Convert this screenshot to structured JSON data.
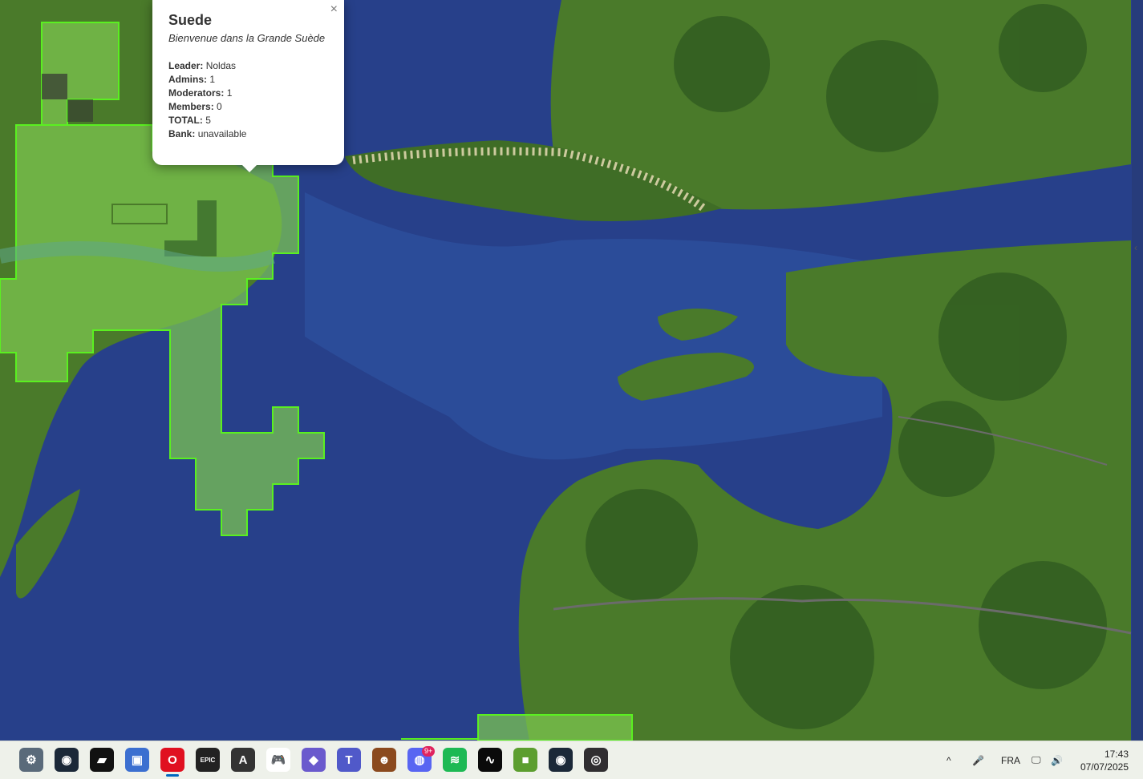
{
  "popup": {
    "title": "Suede",
    "subtitle": "Bienvenue dans la Grande Suède",
    "close_label": "×",
    "leader_label": "Leader:",
    "leader_value": "Noldas",
    "admins_label": "Admins:",
    "admins_value": "1",
    "moderators_label": "Moderators:",
    "moderators_value": "1",
    "members_label": "Members:",
    "members_value": "0",
    "total_label": "TOTAL:",
    "total_value": "5",
    "bank_label": "Bank:",
    "bank_value": "unavailable"
  },
  "colors": {
    "ocean_deep": "#27408a",
    "ocean_shallow": "#2f55a6",
    "land": "#4f7a2a",
    "forest": "#2f5a20",
    "claim_fill": "#7ec850",
    "claim_border": "#5af020",
    "sand": "#e6dbb4",
    "taskbar": "#eef1ea"
  },
  "taskbar": {
    "apps": [
      {
        "name": "settings-icon",
        "glyph": "⚙",
        "color": "#5a6a7a"
      },
      {
        "name": "steam-icon",
        "glyph": "◉",
        "color": "#1b2838"
      },
      {
        "name": "game-launcher-icon",
        "glyph": "▰",
        "color": "#111111"
      },
      {
        "name": "folder-app-icon",
        "glyph": "▣",
        "color": "#3b6fd0"
      },
      {
        "name": "opera-icon",
        "glyph": "O",
        "color": "#e01020"
      },
      {
        "name": "epic-games-icon",
        "glyph": "EPIC",
        "color": "#222222"
      },
      {
        "name": "launcher-a-icon",
        "glyph": "A",
        "color": "#333333"
      },
      {
        "name": "gamepad-icon",
        "glyph": "🎮",
        "color": "#ffffff"
      },
      {
        "name": "vpn-shield-icon",
        "glyph": "◆",
        "color": "#6a5acd"
      },
      {
        "name": "teams-icon",
        "glyph": "T",
        "color": "#5059c9"
      },
      {
        "name": "game-character-icon",
        "glyph": "☻",
        "color": "#8b4a1e"
      },
      {
        "name": "discord-icon",
        "glyph": "◍",
        "color": "#5865f2"
      },
      {
        "name": "spotify-icon",
        "glyph": "≋",
        "color": "#1db954"
      },
      {
        "name": "audio-app-icon",
        "glyph": "∿",
        "color": "#0a0a0a"
      },
      {
        "name": "minecraft-icon",
        "glyph": "■",
        "color": "#5c9e2f"
      },
      {
        "name": "steam-icon-2",
        "glyph": "◉",
        "color": "#1b2838"
      },
      {
        "name": "obs-icon",
        "glyph": "◎",
        "color": "#302e31"
      }
    ],
    "discord_badge": "9+",
    "language": "FRA",
    "time": "17:43",
    "date": "07/07/2025"
  }
}
